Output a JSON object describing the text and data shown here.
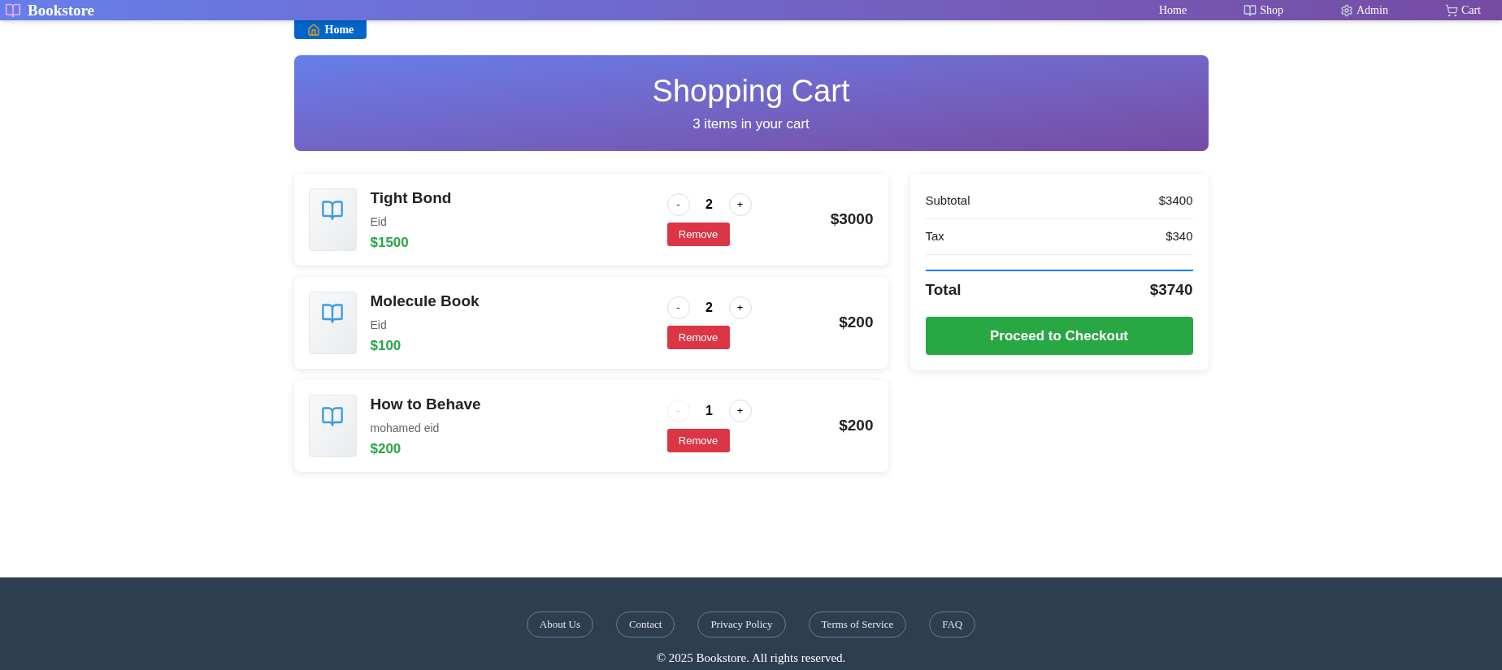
{
  "header": {
    "brand": "Bookstore",
    "nav": [
      {
        "label": "Home"
      },
      {
        "label": "Shop"
      },
      {
        "label": "Admin"
      },
      {
        "label": "Cart"
      }
    ]
  },
  "home_button": "Home",
  "hero": {
    "title": "Shopping Cart",
    "subtitle": "3 items in your cart"
  },
  "items": [
    {
      "title": "Tight Bond",
      "author": "Eid",
      "price": "$1500",
      "quantity": "2",
      "minus_disabled": false,
      "minus": "-",
      "plus": "+",
      "remove": "Remove",
      "line_total": "$3000"
    },
    {
      "title": "Molecule Book",
      "author": "Eid",
      "price": "$100",
      "quantity": "2",
      "minus_disabled": false,
      "minus": "-",
      "plus": "+",
      "remove": "Remove",
      "line_total": "$200"
    },
    {
      "title": "How to Behave",
      "author": "mohamed eid",
      "price": "$200",
      "quantity": "1",
      "minus_disabled": true,
      "minus": "-",
      "plus": "+",
      "remove": "Remove",
      "line_total": "$200"
    }
  ],
  "summary": {
    "rows": [
      {
        "label": "Subtotal",
        "value": "$3400"
      },
      {
        "label": "Tax",
        "value": "$340"
      }
    ],
    "total_label": "Total",
    "total_value": "$3740",
    "checkout": "Proceed to Checkout"
  },
  "footer": {
    "links": [
      "About Us",
      "Contact",
      "Privacy Policy",
      "Terms of Service",
      "FAQ"
    ],
    "copyright": "© 2025 Bookstore. All rights reserved."
  }
}
